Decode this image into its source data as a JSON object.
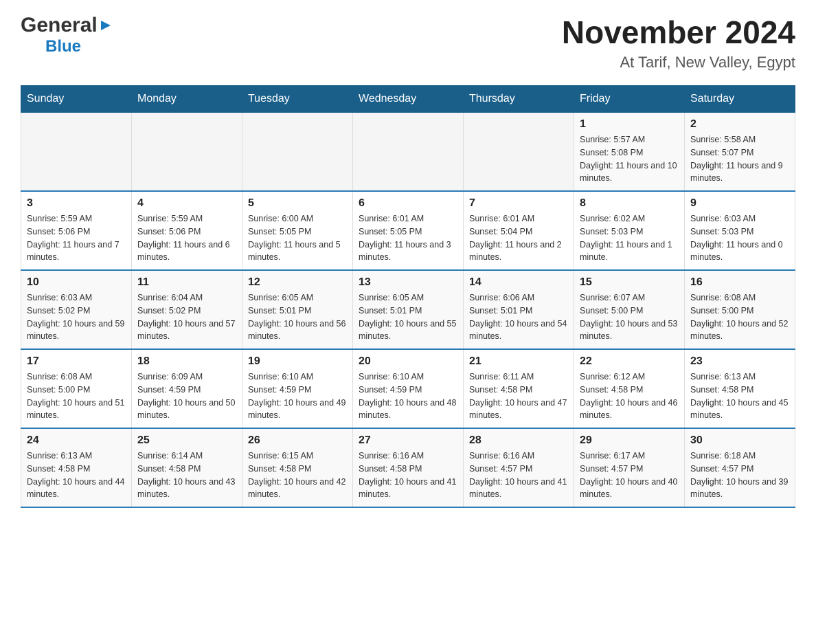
{
  "logo": {
    "general": "General",
    "blue": "Blue",
    "triangle": "▶"
  },
  "title": "November 2024",
  "subtitle": "At Tarif, New Valley, Egypt",
  "days_of_week": [
    "Sunday",
    "Monday",
    "Tuesday",
    "Wednesday",
    "Thursday",
    "Friday",
    "Saturday"
  ],
  "weeks": [
    [
      {
        "num": "",
        "sunrise": "",
        "sunset": "",
        "daylight": ""
      },
      {
        "num": "",
        "sunrise": "",
        "sunset": "",
        "daylight": ""
      },
      {
        "num": "",
        "sunrise": "",
        "sunset": "",
        "daylight": ""
      },
      {
        "num": "",
        "sunrise": "",
        "sunset": "",
        "daylight": ""
      },
      {
        "num": "",
        "sunrise": "",
        "sunset": "",
        "daylight": ""
      },
      {
        "num": "1",
        "sunrise": "Sunrise: 5:57 AM",
        "sunset": "Sunset: 5:08 PM",
        "daylight": "Daylight: 11 hours and 10 minutes."
      },
      {
        "num": "2",
        "sunrise": "Sunrise: 5:58 AM",
        "sunset": "Sunset: 5:07 PM",
        "daylight": "Daylight: 11 hours and 9 minutes."
      }
    ],
    [
      {
        "num": "3",
        "sunrise": "Sunrise: 5:59 AM",
        "sunset": "Sunset: 5:06 PM",
        "daylight": "Daylight: 11 hours and 7 minutes."
      },
      {
        "num": "4",
        "sunrise": "Sunrise: 5:59 AM",
        "sunset": "Sunset: 5:06 PM",
        "daylight": "Daylight: 11 hours and 6 minutes."
      },
      {
        "num": "5",
        "sunrise": "Sunrise: 6:00 AM",
        "sunset": "Sunset: 5:05 PM",
        "daylight": "Daylight: 11 hours and 5 minutes."
      },
      {
        "num": "6",
        "sunrise": "Sunrise: 6:01 AM",
        "sunset": "Sunset: 5:05 PM",
        "daylight": "Daylight: 11 hours and 3 minutes."
      },
      {
        "num": "7",
        "sunrise": "Sunrise: 6:01 AM",
        "sunset": "Sunset: 5:04 PM",
        "daylight": "Daylight: 11 hours and 2 minutes."
      },
      {
        "num": "8",
        "sunrise": "Sunrise: 6:02 AM",
        "sunset": "Sunset: 5:03 PM",
        "daylight": "Daylight: 11 hours and 1 minute."
      },
      {
        "num": "9",
        "sunrise": "Sunrise: 6:03 AM",
        "sunset": "Sunset: 5:03 PM",
        "daylight": "Daylight: 11 hours and 0 minutes."
      }
    ],
    [
      {
        "num": "10",
        "sunrise": "Sunrise: 6:03 AM",
        "sunset": "Sunset: 5:02 PM",
        "daylight": "Daylight: 10 hours and 59 minutes."
      },
      {
        "num": "11",
        "sunrise": "Sunrise: 6:04 AM",
        "sunset": "Sunset: 5:02 PM",
        "daylight": "Daylight: 10 hours and 57 minutes."
      },
      {
        "num": "12",
        "sunrise": "Sunrise: 6:05 AM",
        "sunset": "Sunset: 5:01 PM",
        "daylight": "Daylight: 10 hours and 56 minutes."
      },
      {
        "num": "13",
        "sunrise": "Sunrise: 6:05 AM",
        "sunset": "Sunset: 5:01 PM",
        "daylight": "Daylight: 10 hours and 55 minutes."
      },
      {
        "num": "14",
        "sunrise": "Sunrise: 6:06 AM",
        "sunset": "Sunset: 5:01 PM",
        "daylight": "Daylight: 10 hours and 54 minutes."
      },
      {
        "num": "15",
        "sunrise": "Sunrise: 6:07 AM",
        "sunset": "Sunset: 5:00 PM",
        "daylight": "Daylight: 10 hours and 53 minutes."
      },
      {
        "num": "16",
        "sunrise": "Sunrise: 6:08 AM",
        "sunset": "Sunset: 5:00 PM",
        "daylight": "Daylight: 10 hours and 52 minutes."
      }
    ],
    [
      {
        "num": "17",
        "sunrise": "Sunrise: 6:08 AM",
        "sunset": "Sunset: 5:00 PM",
        "daylight": "Daylight: 10 hours and 51 minutes."
      },
      {
        "num": "18",
        "sunrise": "Sunrise: 6:09 AM",
        "sunset": "Sunset: 4:59 PM",
        "daylight": "Daylight: 10 hours and 50 minutes."
      },
      {
        "num": "19",
        "sunrise": "Sunrise: 6:10 AM",
        "sunset": "Sunset: 4:59 PM",
        "daylight": "Daylight: 10 hours and 49 minutes."
      },
      {
        "num": "20",
        "sunrise": "Sunrise: 6:10 AM",
        "sunset": "Sunset: 4:59 PM",
        "daylight": "Daylight: 10 hours and 48 minutes."
      },
      {
        "num": "21",
        "sunrise": "Sunrise: 6:11 AM",
        "sunset": "Sunset: 4:58 PM",
        "daylight": "Daylight: 10 hours and 47 minutes."
      },
      {
        "num": "22",
        "sunrise": "Sunrise: 6:12 AM",
        "sunset": "Sunset: 4:58 PM",
        "daylight": "Daylight: 10 hours and 46 minutes."
      },
      {
        "num": "23",
        "sunrise": "Sunrise: 6:13 AM",
        "sunset": "Sunset: 4:58 PM",
        "daylight": "Daylight: 10 hours and 45 minutes."
      }
    ],
    [
      {
        "num": "24",
        "sunrise": "Sunrise: 6:13 AM",
        "sunset": "Sunset: 4:58 PM",
        "daylight": "Daylight: 10 hours and 44 minutes."
      },
      {
        "num": "25",
        "sunrise": "Sunrise: 6:14 AM",
        "sunset": "Sunset: 4:58 PM",
        "daylight": "Daylight: 10 hours and 43 minutes."
      },
      {
        "num": "26",
        "sunrise": "Sunrise: 6:15 AM",
        "sunset": "Sunset: 4:58 PM",
        "daylight": "Daylight: 10 hours and 42 minutes."
      },
      {
        "num": "27",
        "sunrise": "Sunrise: 6:16 AM",
        "sunset": "Sunset: 4:58 PM",
        "daylight": "Daylight: 10 hours and 41 minutes."
      },
      {
        "num": "28",
        "sunrise": "Sunrise: 6:16 AM",
        "sunset": "Sunset: 4:57 PM",
        "daylight": "Daylight: 10 hours and 41 minutes."
      },
      {
        "num": "29",
        "sunrise": "Sunrise: 6:17 AM",
        "sunset": "Sunset: 4:57 PM",
        "daylight": "Daylight: 10 hours and 40 minutes."
      },
      {
        "num": "30",
        "sunrise": "Sunrise: 6:18 AM",
        "sunset": "Sunset: 4:57 PM",
        "daylight": "Daylight: 10 hours and 39 minutes."
      }
    ]
  ]
}
